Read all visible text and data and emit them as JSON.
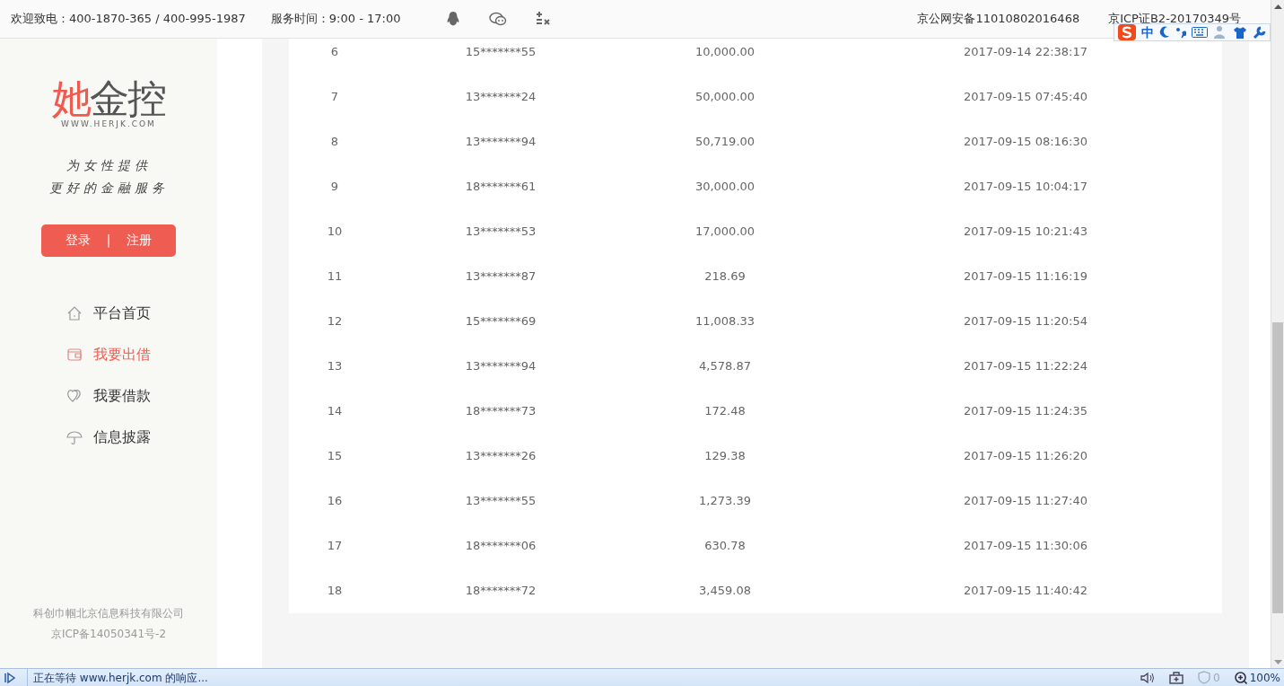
{
  "top_bar": {
    "hotline": "欢迎致电：400-1870-365 / 400-995-1987",
    "service_hours": "服务时间：9:00 - 17:00",
    "records": [
      "京公网安备11010802016468",
      "京ICP证B2-20170349号"
    ]
  },
  "sidebar": {
    "logo": {
      "accent": "她",
      "rest": "金控",
      "url": "WWW.HERJK.COM"
    },
    "slogan": [
      "为女性提供",
      "更好的金融服务"
    ],
    "auth": {
      "login": "登录",
      "separator": "|",
      "register": "注册"
    },
    "nav": [
      {
        "label": "平台首页",
        "selected": false
      },
      {
        "label": "我要出借",
        "selected": true
      },
      {
        "label": "我要借款",
        "selected": false
      },
      {
        "label": "信息披露",
        "selected": false
      }
    ],
    "footer": [
      "科创巾帼北京信息科技有限公司",
      "京ICP备14050341号-2"
    ]
  },
  "table": {
    "rows": [
      [
        "6",
        "15*******55",
        "10,000.00",
        "2017-09-14 22:38:17"
      ],
      [
        "7",
        "13*******24",
        "50,000.00",
        "2017-09-15 07:45:40"
      ],
      [
        "8",
        "13*******94",
        "50,719.00",
        "2017-09-15 08:16:30"
      ],
      [
        "9",
        "18*******61",
        "30,000.00",
        "2017-09-15 10:04:17"
      ],
      [
        "10",
        "13*******53",
        "17,000.00",
        "2017-09-15 10:21:43"
      ],
      [
        "11",
        "13*******87",
        "218.69",
        "2017-09-15 11:16:19"
      ],
      [
        "12",
        "15*******69",
        "11,008.33",
        "2017-09-15 11:20:54"
      ],
      [
        "13",
        "13*******94",
        "4,578.87",
        "2017-09-15 11:22:24"
      ],
      [
        "14",
        "18*******73",
        "172.48",
        "2017-09-15 11:24:35"
      ],
      [
        "15",
        "13*******26",
        "129.38",
        "2017-09-15 11:26:20"
      ],
      [
        "16",
        "13*******55",
        "1,273.39",
        "2017-09-15 11:27:40"
      ],
      [
        "17",
        "18*******06",
        "630.78",
        "2017-09-15 11:30:06"
      ],
      [
        "18",
        "18*******72",
        "3,459.08",
        "2017-09-15 11:40:42"
      ]
    ]
  },
  "ime_toolbar": {
    "mode": "中"
  },
  "status_bar": {
    "message": "正在等待 www.herjk.com 的响应...",
    "ad_count": "0",
    "zoom": "100%"
  }
}
